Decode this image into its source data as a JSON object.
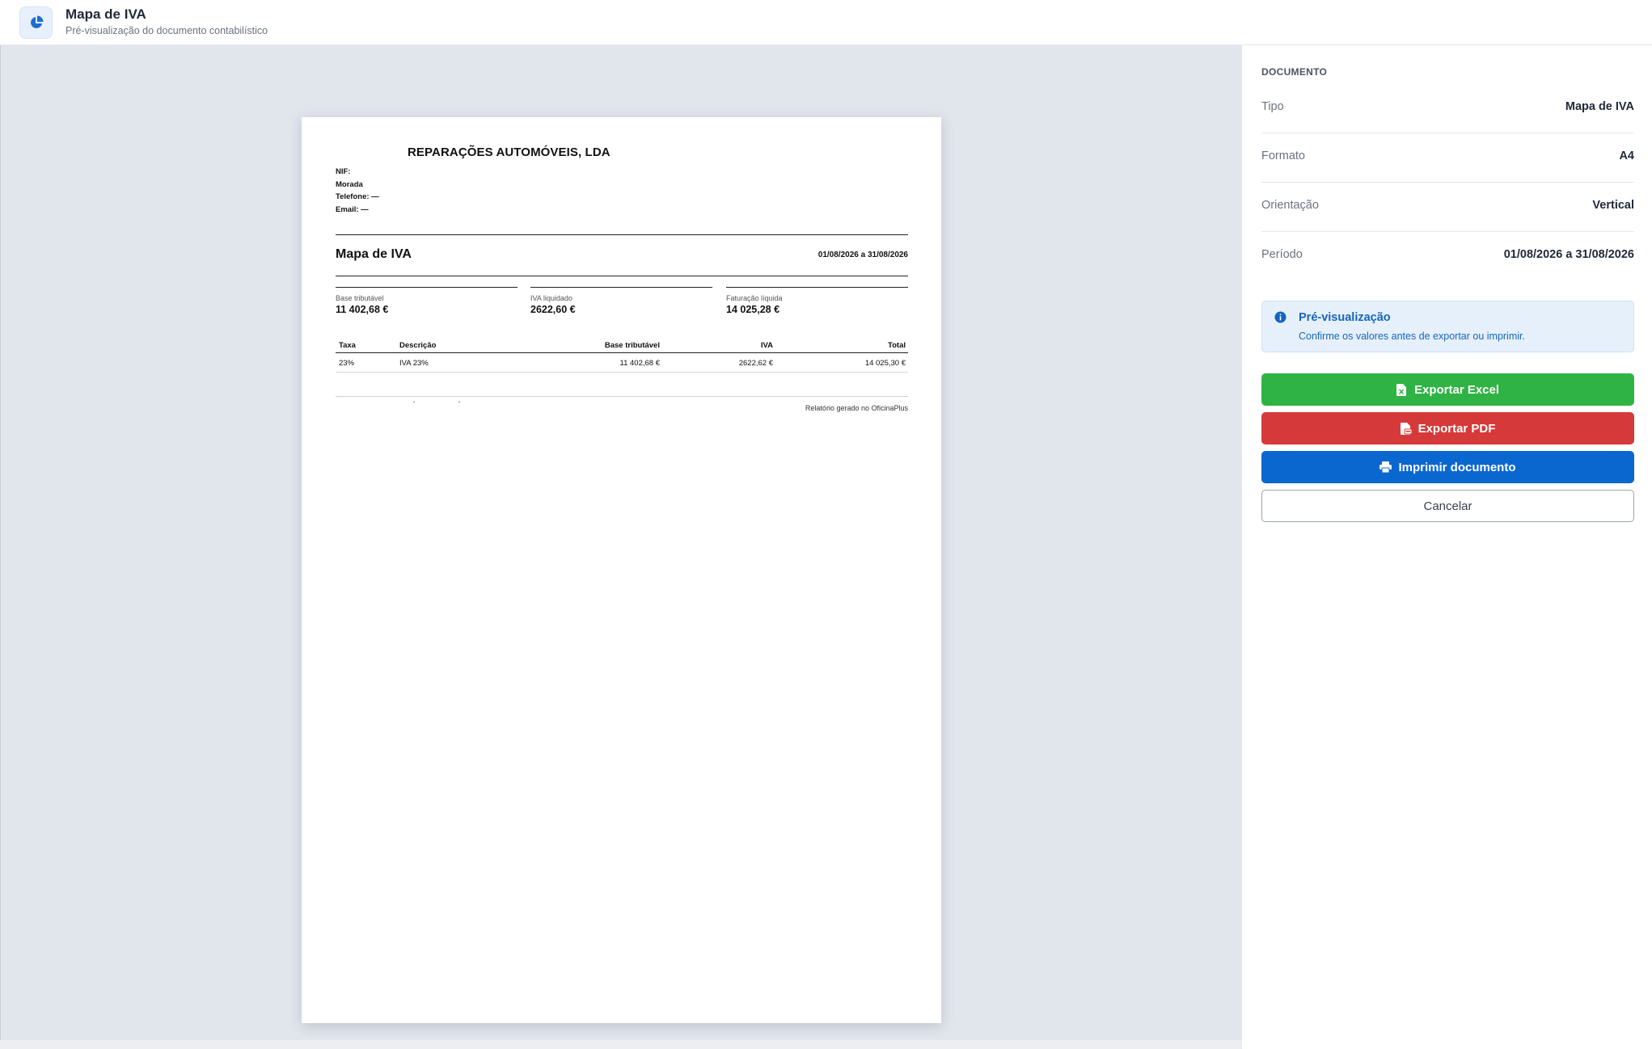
{
  "header": {
    "title": "Mapa de IVA",
    "subtitle": "Pré-visualização do documento contabilístico"
  },
  "document": {
    "company_name": "REPARAÇÕES AUTOMÓVEIS, LDA",
    "nif_label": "NIF:",
    "morada_label": "Morada",
    "telefone": "Telefone: —",
    "email": "Email: —",
    "title": "Mapa de IVA",
    "period": "01/08/2026 a 31/08/2026",
    "summary": [
      {
        "label": "Base tributável",
        "value": "11 402,68 €"
      },
      {
        "label": "IVA liquidado",
        "value": "2622,60 €"
      },
      {
        "label": "Faturação líquida",
        "value": "14 025,28 €"
      }
    ],
    "table": {
      "headers": {
        "taxa": "Taxa",
        "descricao": "Descrição",
        "base": "Base tributável",
        "iva": "IVA",
        "total": "Total"
      },
      "rows": [
        {
          "taxa": "23%",
          "descricao": "IVA 23%",
          "base": "11 402,68 €",
          "iva": "2622,62 €",
          "total": "14 025,30 €"
        }
      ]
    },
    "footer": "Relatório gerado no OficinaPlus"
  },
  "sidebar": {
    "section_title": "DOCUMENTO",
    "rows": [
      {
        "label": "Tipo",
        "value": "Mapa de IVA"
      },
      {
        "label": "Formato",
        "value": "A4"
      },
      {
        "label": "Orientação",
        "value": "Vertical"
      },
      {
        "label": "Período",
        "value": "01/08/2026 a 31/08/2026"
      }
    ],
    "info": {
      "title": "Pré-visualização",
      "text": "Confirme os valores antes de exportar ou imprimir."
    },
    "buttons": {
      "excel": "Exportar Excel",
      "pdf": "Exportar PDF",
      "print": "Imprimir documento",
      "cancel": "Cancelar"
    }
  },
  "colors": {
    "excel": "#2fb344",
    "pdf": "#d6393a",
    "print": "#0a67d0",
    "info_accent": "#1565c0",
    "preview_bg": "#e1e6ed"
  },
  "icons": {
    "header": "pie-chart-icon",
    "info": "info-circle-icon",
    "excel": "file-excel-icon",
    "pdf": "file-pdf-icon",
    "print": "printer-icon"
  }
}
